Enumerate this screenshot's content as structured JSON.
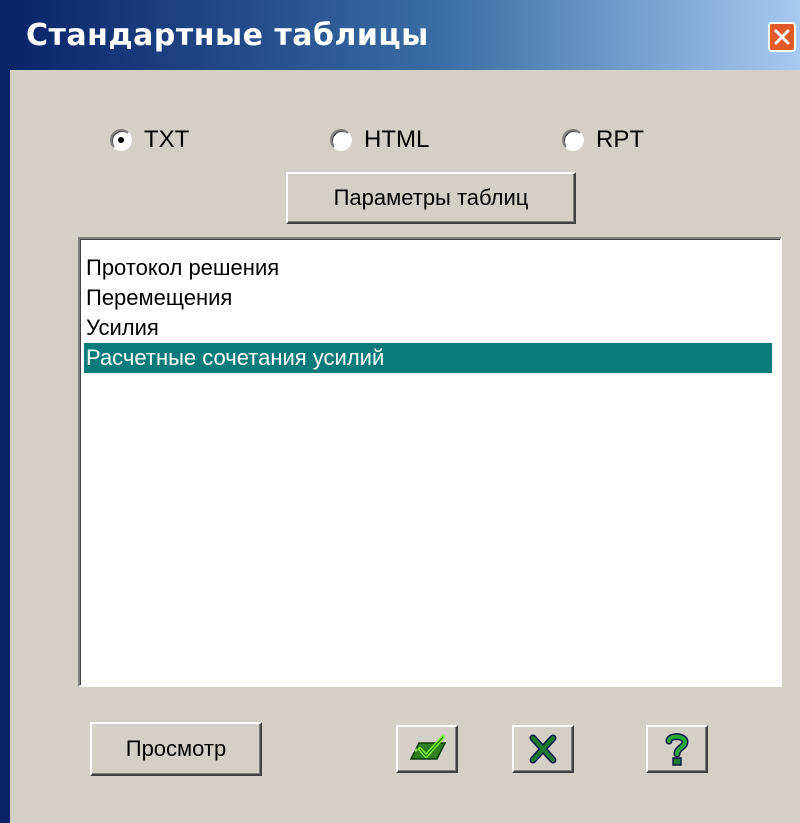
{
  "window": {
    "title": "Стандартные таблицы",
    "close_icon": "close-icon",
    "titlebar_color": "#0a246a",
    "face_color": "#d4d0c8"
  },
  "format": {
    "options": [
      {
        "label": "TXT",
        "checked": true
      },
      {
        "label": "HTML",
        "checked": false
      },
      {
        "label": "RPT",
        "checked": false
      }
    ]
  },
  "params_button": {
    "label": "Параметры таблиц"
  },
  "table_list": {
    "items": [
      "Протокол решения",
      "Перемещения",
      "Усилия",
      "Расчетные сочетания усилий"
    ],
    "selected_item": "Расчетные сочетания усилий",
    "selection_color": "#0a7a7a"
  },
  "footer": {
    "preview_label": "Просмотр",
    "ok_icon": "checkmark-icon",
    "cancel_icon": "cancel-x-icon",
    "help_icon": "help-question-icon"
  }
}
